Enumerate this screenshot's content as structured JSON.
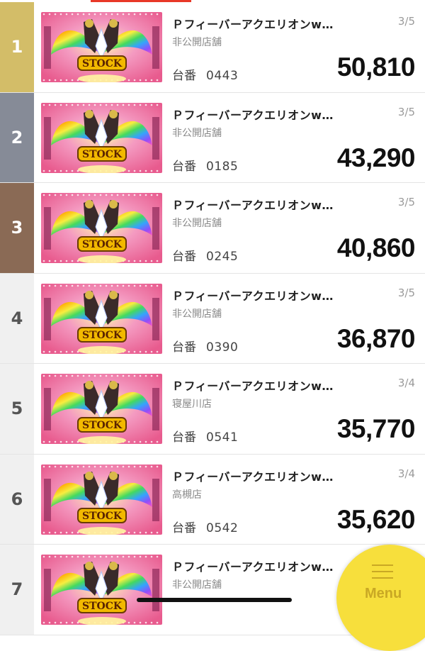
{
  "header": {
    "accent_color": "#e83828"
  },
  "ranking": [
    {
      "rank": "1",
      "title": "Ｐフィーバーアクエリオンw…",
      "fraction": "3/5",
      "store": "非公開店舗",
      "machine_label": "台番",
      "machine_no": "0443",
      "amount": "50,810"
    },
    {
      "rank": "2",
      "title": "Ｐフィーバーアクエリオンw…",
      "fraction": "3/5",
      "store": "非公開店舗",
      "machine_label": "台番",
      "machine_no": "0185",
      "amount": "43,290"
    },
    {
      "rank": "3",
      "title": "Ｐフィーバーアクエリオンw…",
      "fraction": "3/5",
      "store": "非公開店舗",
      "machine_label": "台番",
      "machine_no": "0245",
      "amount": "40,860"
    },
    {
      "rank": "4",
      "title": "Ｐフィーバーアクエリオンw…",
      "fraction": "3/5",
      "store": "非公開店舗",
      "machine_label": "台番",
      "machine_no": "0390",
      "amount": "36,870"
    },
    {
      "rank": "5",
      "title": "Ｐフィーバーアクエリオンw…",
      "fraction": "3/4",
      "store": "寝屋川店",
      "machine_label": "台番",
      "machine_no": "0541",
      "amount": "35,770"
    },
    {
      "rank": "6",
      "title": "Ｐフィーバーアクエリオンw…",
      "fraction": "3/4",
      "store": "高槻店",
      "machine_label": "台番",
      "machine_no": "0542",
      "amount": "35,620"
    },
    {
      "rank": "7",
      "title": "Ｐフィーバーアクエリオンw…",
      "fraction": "",
      "store": "非公開店舗",
      "machine_label": "",
      "machine_no": "",
      "amount": ""
    }
  ],
  "thumbnail": {
    "stock_text": "STOCK",
    "icon": "pachinko-machine-image"
  },
  "menu_button": {
    "label": "Menu",
    "icon": "hamburger-icon",
    "color": "#f7df3c"
  },
  "colors": {
    "gold": "#d3bd68",
    "silver": "#868b97",
    "bronze": "#8a6a55"
  }
}
